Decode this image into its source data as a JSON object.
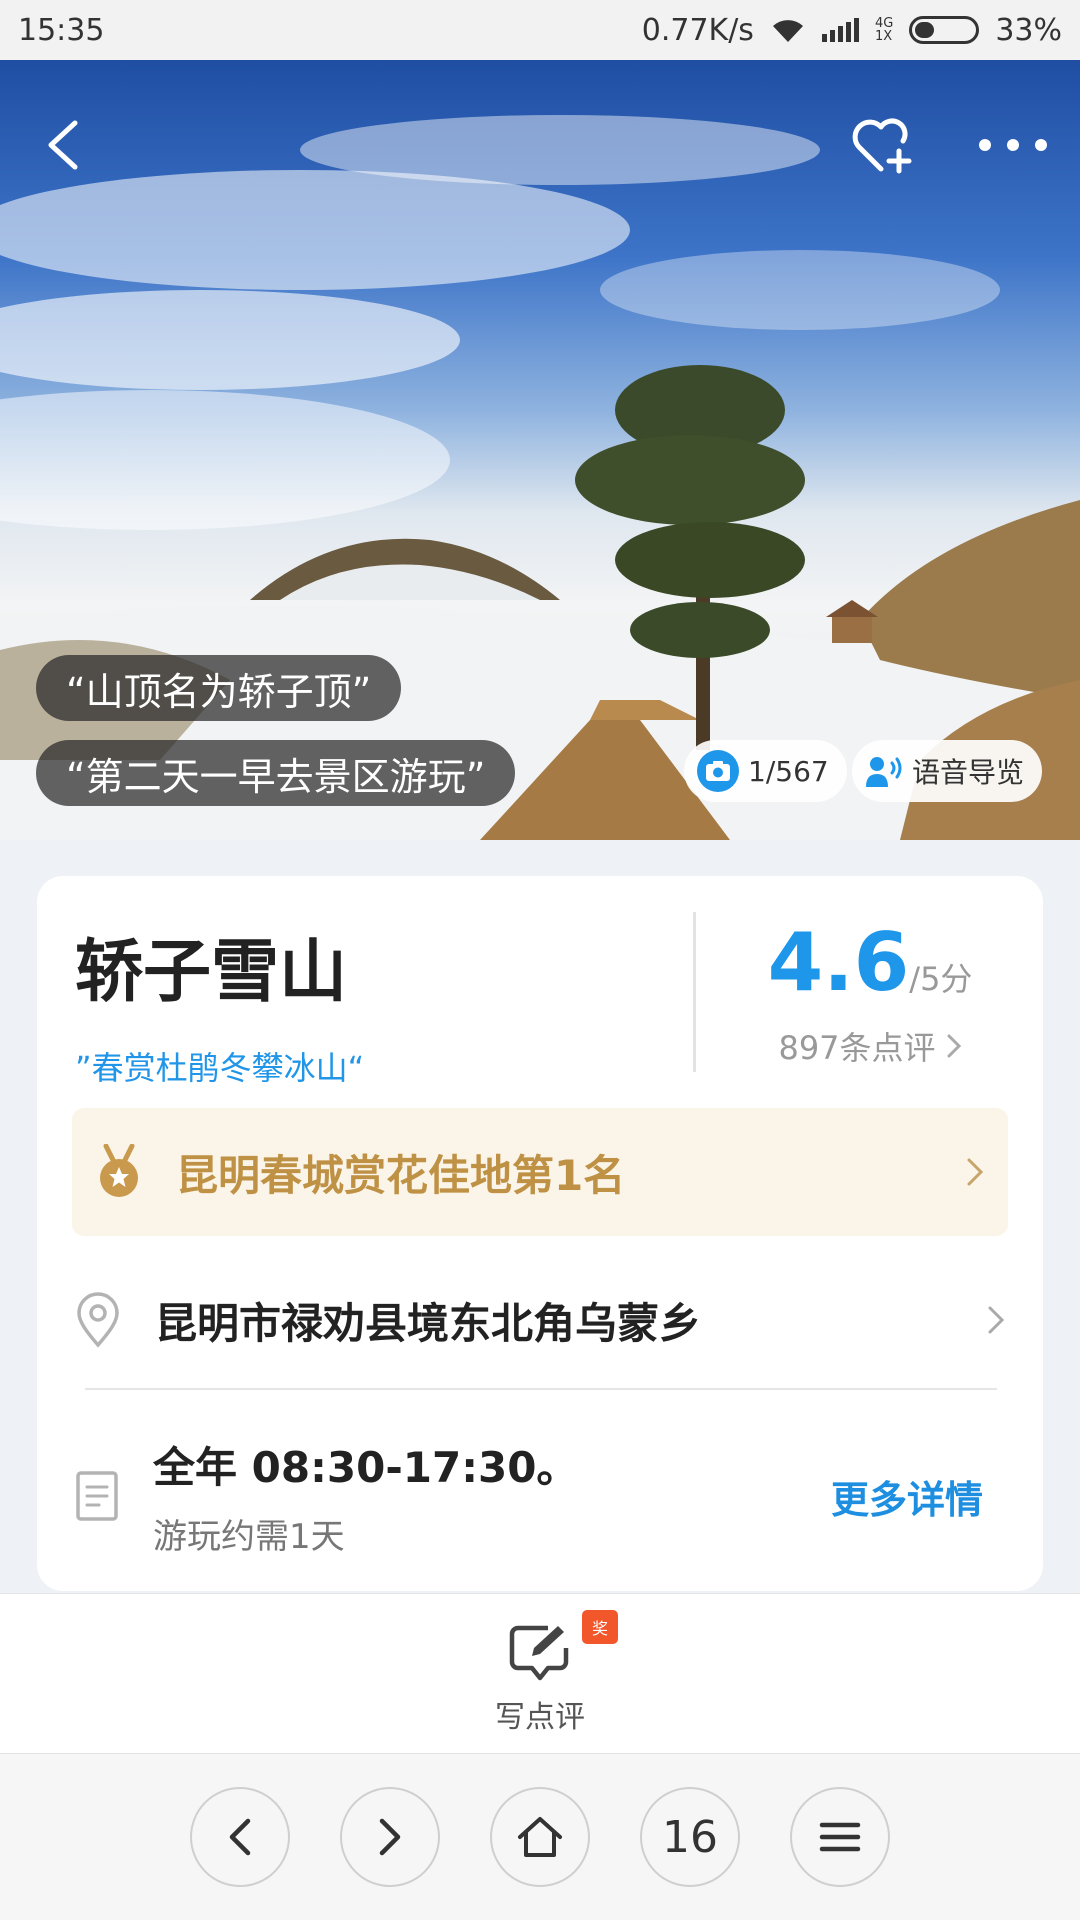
{
  "status_bar": {
    "time": "15:35",
    "network_speed": "0.77K/s",
    "net_type_top": "4G",
    "net_type_bottom": "1X",
    "battery": "33%",
    "battery_level": 0.33
  },
  "hero": {
    "quotes": [
      "“山顶名为轿子顶”",
      "“第二天一早去景区游玩”"
    ],
    "photo_counter": "1/567",
    "audio_guide": "语音导览",
    "icons": [
      "back-icon",
      "favorite-add-icon",
      "more-icon",
      "camera-icon",
      "audio-guide-icon"
    ]
  },
  "info": {
    "title": "轿子雪山",
    "slogan": "”春赏杜鹃冬攀冰山“",
    "score": "4.6",
    "score_max": "/5分",
    "reviews": "897条点评",
    "rank": "昆明春城赏花佳地第1名",
    "address": "昆明市禄劝县境东北角乌蒙乡",
    "hours": "全年 08:30-17:30。",
    "duration": "游玩约需1天",
    "more": "更多详情"
  },
  "review_bar": {
    "label": "写点评",
    "badge": "奖"
  },
  "browser_nav": {
    "tabs_count": "16"
  },
  "colors": {
    "accent_blue": "#1e97ea",
    "rank_gold": "#bf9145",
    "rank_bg": "#fbf4e8",
    "badge_red": "#f2562b"
  }
}
